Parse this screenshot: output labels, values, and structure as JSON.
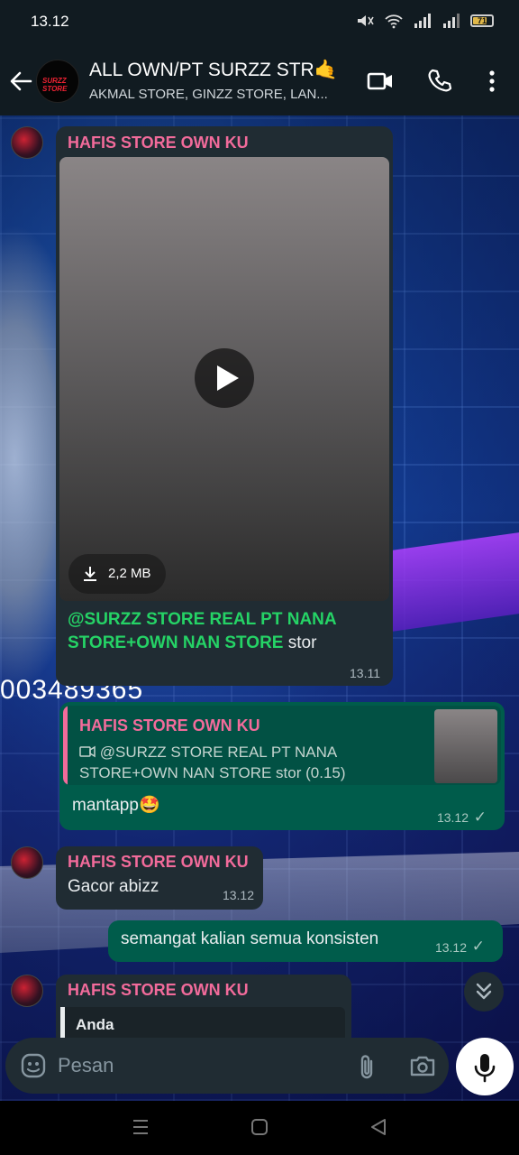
{
  "status": {
    "time": "13.12",
    "battery": "71"
  },
  "header": {
    "title": "ALL OWN/PT SURZZ STR🤙",
    "subtitle": "AKMAL STORE, GINZZ STORE, LAN...",
    "avatar_text": "SURZZ STORE"
  },
  "wallpaper": {
    "number_text": "003489365"
  },
  "messages": [
    {
      "type": "incoming-video",
      "sender": "HAFIS STORE OWN KU",
      "file_size": "2,2 MB",
      "caption_mention": "@SURZZ STORE REAL PT NANA STORE+OWN NAN STORE",
      "caption_rest": " stor",
      "time": "13.11"
    },
    {
      "type": "outgoing-reply",
      "quote_sender": "HAFIS STORE OWN KU",
      "quote_text": "@SURZZ STORE REAL PT NANA STORE+OWN NAN STORE stor (0.15)",
      "text": "mantapp🤩",
      "time": "13.12",
      "tick": "✓"
    },
    {
      "type": "incoming",
      "sender": "HAFIS STORE OWN KU",
      "text": "Gacor abizz",
      "time": "13.12"
    },
    {
      "type": "outgoing",
      "text": "semangat kalian semua konsisten",
      "time": "13.12",
      "tick": "✓"
    },
    {
      "type": "incoming-partial",
      "sender": "HAFIS STORE OWN KU",
      "quote_sender": "Anda"
    }
  ],
  "composer": {
    "placeholder": "Pesan"
  },
  "colors": {
    "header_bg": "#111b21",
    "incoming_bubble": "#202c33",
    "outgoing_bubble": "#005c4b",
    "sender_name": "#f26b9b",
    "mention": "#25d366"
  },
  "icons": [
    "back-arrow-icon",
    "video-call-icon",
    "phone-icon",
    "more-vert-icon",
    "play-icon",
    "download-icon",
    "video-small-icon",
    "chevron-double-down-icon",
    "emoji-icon",
    "attach-icon",
    "camera-icon",
    "mic-icon"
  ]
}
